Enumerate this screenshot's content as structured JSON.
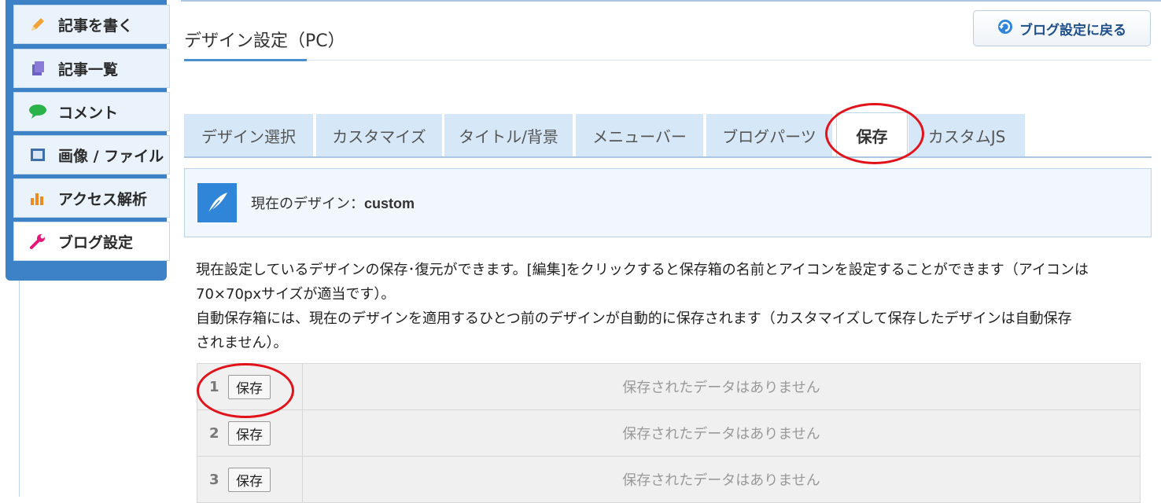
{
  "sidebar": {
    "items": [
      {
        "label": "記事を書く",
        "icon": "pencil-icon"
      },
      {
        "label": "記事一覧",
        "icon": "document-list-icon"
      },
      {
        "label": "コメント",
        "icon": "speech-bubble-icon"
      },
      {
        "label": "画像 / ファイル",
        "icon": "image-file-icon"
      },
      {
        "label": "アクセス解析",
        "icon": "bar-chart-icon"
      },
      {
        "label": "ブログ設定",
        "icon": "wrench-icon"
      }
    ],
    "active_index": 5
  },
  "page": {
    "title": "デザイン設定（PC）",
    "back_button_label": "ブログ設定に戻る"
  },
  "tabs": [
    {
      "label": "デザイン選択"
    },
    {
      "label": "カスタマイズ"
    },
    {
      "label": "タイトル/背景"
    },
    {
      "label": "メニューバー"
    },
    {
      "label": "ブログパーツ"
    },
    {
      "label": "保存",
      "active": true
    },
    {
      "label": "カスタムJS"
    }
  ],
  "current_design": {
    "label": "現在のデザイン：",
    "value": "custom"
  },
  "description": {
    "line1": "現在設定しているデザインの保存･復元ができます。[編集]をクリックすると保存箱の名前とアイコンを設定することができます（アイコンは",
    "line2": "70×70pxサイズが適当です）。",
    "line3": "自動保存箱には、現在のデザインを適用するひとつ前のデザインが自動的に保存されます（カスタマイズして保存したデザインは自動保存",
    "line4": "されません）。"
  },
  "save_slots": [
    {
      "number": "1",
      "button_label": "保存",
      "message": "保存されたデータはありません"
    },
    {
      "number": "2",
      "button_label": "保存",
      "message": "保存されたデータはありません"
    },
    {
      "number": "3",
      "button_label": "保存",
      "message": "保存されたデータはありません"
    }
  ],
  "colors": {
    "sidebar_blue": "#3d82c6",
    "tab_bg": "#d6e8f8",
    "highlight_ring": "#e2121a",
    "accent": "#2f86d8"
  }
}
